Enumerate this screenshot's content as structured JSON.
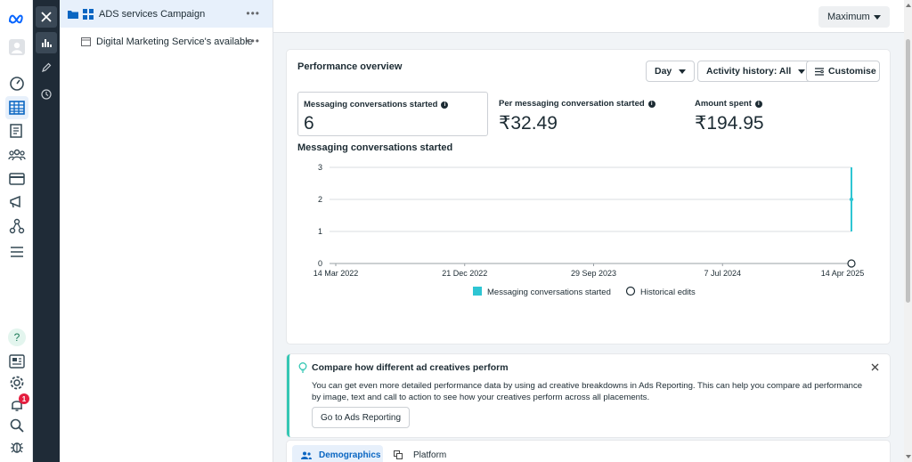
{
  "rail": {
    "icons": [
      "meta-logo-icon",
      "profile-avatar-icon",
      "dashboard-gauge-icon",
      "campaigns-table-icon",
      "pages-icon",
      "audiences-icon",
      "billing-card-icon",
      "advertise-megaphone-icon",
      "events-manager-icon",
      "menu-icon",
      "help-icon",
      "news-icon",
      "settings-gear-icon",
      "notifications-bell-icon",
      "search-icon",
      "bug-icon"
    ],
    "notification_count": "1"
  },
  "tree": {
    "campaign": "ADS services Campaign",
    "adset": "Digital Marketing Service's available",
    "more": "•••"
  },
  "topbar": {
    "maximum_label": "Maximum"
  },
  "performance": {
    "title": "Performance overview",
    "day_label": "Day",
    "activity_label": "Activity history: All",
    "customise_label": "Customise",
    "metrics": [
      {
        "label": "Messaging conversations started",
        "value": "6"
      },
      {
        "label": "Per messaging conversation started",
        "value": "₹32.49"
      },
      {
        "label": "Amount spent",
        "value": "₹194.95"
      }
    ],
    "chart_title": "Messaging conversations started"
  },
  "chart_data": {
    "type": "line",
    "title": "Messaging conversations started",
    "x": [
      "14 Mar 2022",
      "21 Dec 2022",
      "29 Sep 2023",
      "7 Jul 2024",
      "14 Apr 2025"
    ],
    "yticks": [
      "0",
      "1",
      "2",
      "3"
    ],
    "ylim": [
      0,
      3
    ],
    "series": [
      {
        "name": "Messaging conversations started",
        "color": "#2ec5d3",
        "values": [
          0,
          0,
          0,
          0,
          3
        ]
      }
    ],
    "point": {
      "x": "14 Apr 2025",
      "y": 2
    },
    "legend": [
      "Messaging conversations started",
      "Historical edits"
    ],
    "legend_position": "bottom",
    "grid": true
  },
  "tip": {
    "title": "Compare how different ad creatives perform",
    "body": "You can get even more detailed performance data by using ad creative breakdowns in Ads Reporting. This can help you compare ad performance by image, text and call to action to see how your creatives perform across all placements.",
    "button": "Go to Ads Reporting",
    "accent": "#35c7b4"
  },
  "tabs": [
    {
      "label": "Demographics"
    },
    {
      "label": "Platform"
    }
  ],
  "colors": {
    "accent": "#0a66c2",
    "series": "#2ec5d3",
    "badge": "#e41e3f"
  }
}
